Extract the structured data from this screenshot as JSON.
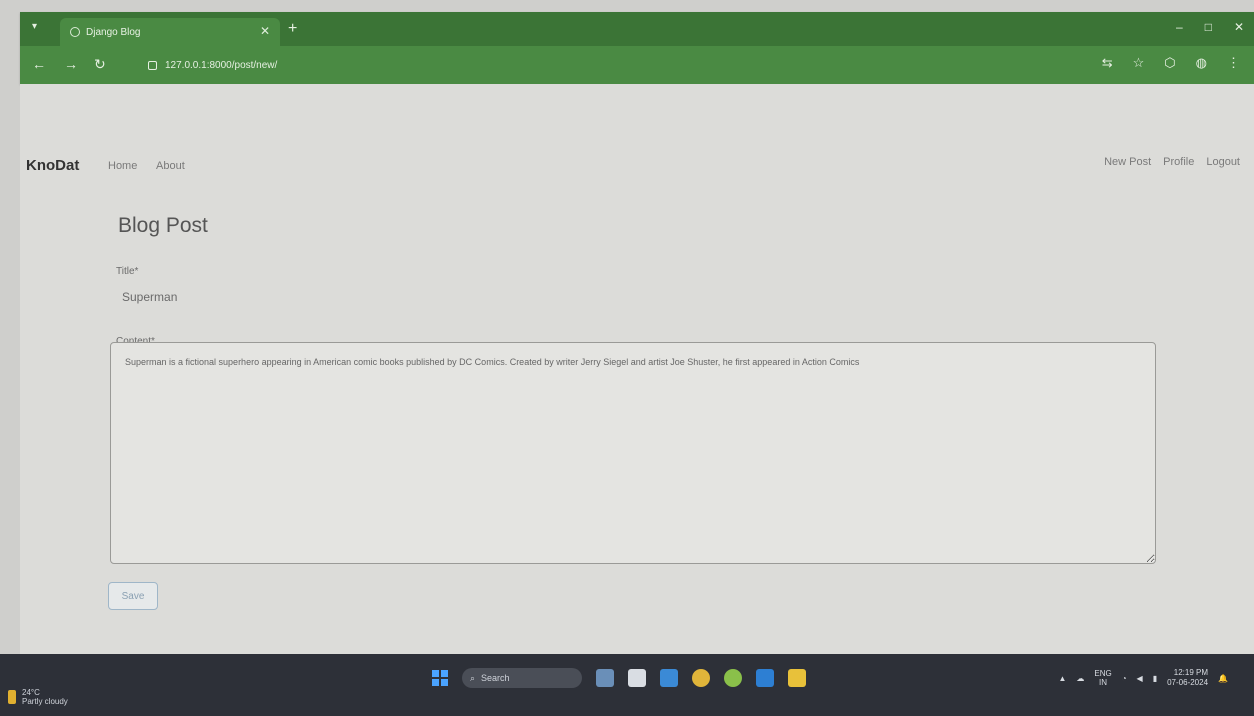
{
  "browser": {
    "tab_title": "Django Blog",
    "url": "127.0.0.1:8000/post/new/",
    "window_controls": [
      "–",
      "□",
      "✕"
    ]
  },
  "navbar": {
    "brand": "KnoDat",
    "left_links": [
      "Home",
      "About"
    ],
    "right_links": [
      "New Post",
      "Profile",
      "Logout"
    ]
  },
  "form": {
    "heading": "Blog Post",
    "title_label": "Title*",
    "title_value": "Superman",
    "content_label": "Content*",
    "content_value": "Superman is a fictional superhero appearing in American comic books published by DC Comics. Created by writer Jerry Siegel and artist Joe Shuster, he first appeared in Action Comics",
    "save_label": "Save"
  },
  "taskbar": {
    "weather_temp": "24°C",
    "weather_desc": "Partly cloudy",
    "search_label": "Search",
    "lang": "ENG",
    "lang_sub": "IN",
    "time": "12:19 PM",
    "date": "07-06-2024"
  },
  "colors": {
    "chrome_green": "#4a8a43",
    "page_bg": "#dcdcd9",
    "taskbar_bg": "#2d3038"
  }
}
